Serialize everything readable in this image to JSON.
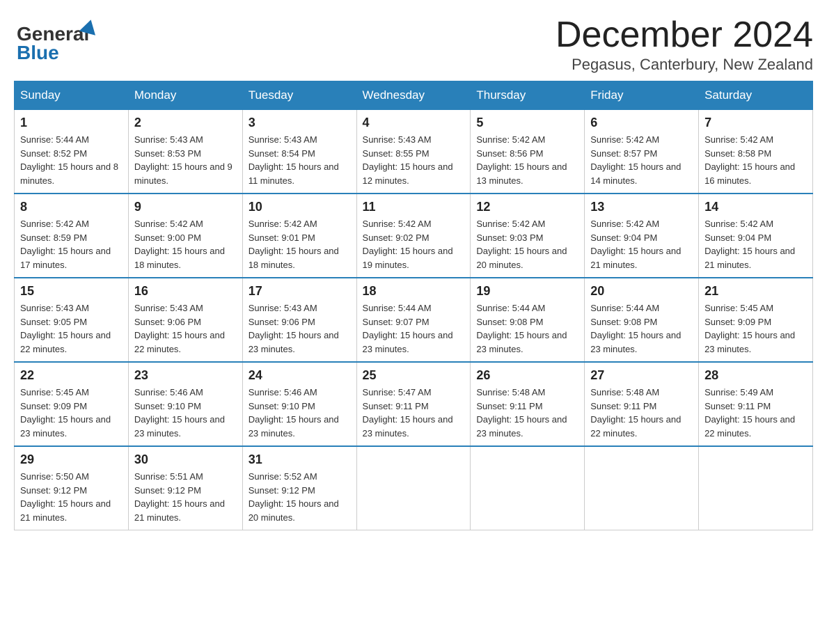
{
  "header": {
    "logo_text_general": "General",
    "logo_text_blue": "Blue",
    "month_title": "December 2024",
    "location": "Pegasus, Canterbury, New Zealand"
  },
  "days_of_week": [
    "Sunday",
    "Monday",
    "Tuesday",
    "Wednesday",
    "Thursday",
    "Friday",
    "Saturday"
  ],
  "weeks": [
    [
      {
        "day": "1",
        "sunrise": "5:44 AM",
        "sunset": "8:52 PM",
        "daylight": "15 hours and 8 minutes."
      },
      {
        "day": "2",
        "sunrise": "5:43 AM",
        "sunset": "8:53 PM",
        "daylight": "15 hours and 9 minutes."
      },
      {
        "day": "3",
        "sunrise": "5:43 AM",
        "sunset": "8:54 PM",
        "daylight": "15 hours and 11 minutes."
      },
      {
        "day": "4",
        "sunrise": "5:43 AM",
        "sunset": "8:55 PM",
        "daylight": "15 hours and 12 minutes."
      },
      {
        "day": "5",
        "sunrise": "5:42 AM",
        "sunset": "8:56 PM",
        "daylight": "15 hours and 13 minutes."
      },
      {
        "day": "6",
        "sunrise": "5:42 AM",
        "sunset": "8:57 PM",
        "daylight": "15 hours and 14 minutes."
      },
      {
        "day": "7",
        "sunrise": "5:42 AM",
        "sunset": "8:58 PM",
        "daylight": "15 hours and 16 minutes."
      }
    ],
    [
      {
        "day": "8",
        "sunrise": "5:42 AM",
        "sunset": "8:59 PM",
        "daylight": "15 hours and 17 minutes."
      },
      {
        "day": "9",
        "sunrise": "5:42 AM",
        "sunset": "9:00 PM",
        "daylight": "15 hours and 18 minutes."
      },
      {
        "day": "10",
        "sunrise": "5:42 AM",
        "sunset": "9:01 PM",
        "daylight": "15 hours and 18 minutes."
      },
      {
        "day": "11",
        "sunrise": "5:42 AM",
        "sunset": "9:02 PM",
        "daylight": "15 hours and 19 minutes."
      },
      {
        "day": "12",
        "sunrise": "5:42 AM",
        "sunset": "9:03 PM",
        "daylight": "15 hours and 20 minutes."
      },
      {
        "day": "13",
        "sunrise": "5:42 AM",
        "sunset": "9:04 PM",
        "daylight": "15 hours and 21 minutes."
      },
      {
        "day": "14",
        "sunrise": "5:42 AM",
        "sunset": "9:04 PM",
        "daylight": "15 hours and 21 minutes."
      }
    ],
    [
      {
        "day": "15",
        "sunrise": "5:43 AM",
        "sunset": "9:05 PM",
        "daylight": "15 hours and 22 minutes."
      },
      {
        "day": "16",
        "sunrise": "5:43 AM",
        "sunset": "9:06 PM",
        "daylight": "15 hours and 22 minutes."
      },
      {
        "day": "17",
        "sunrise": "5:43 AM",
        "sunset": "9:06 PM",
        "daylight": "15 hours and 23 minutes."
      },
      {
        "day": "18",
        "sunrise": "5:44 AM",
        "sunset": "9:07 PM",
        "daylight": "15 hours and 23 minutes."
      },
      {
        "day": "19",
        "sunrise": "5:44 AM",
        "sunset": "9:08 PM",
        "daylight": "15 hours and 23 minutes."
      },
      {
        "day": "20",
        "sunrise": "5:44 AM",
        "sunset": "9:08 PM",
        "daylight": "15 hours and 23 minutes."
      },
      {
        "day": "21",
        "sunrise": "5:45 AM",
        "sunset": "9:09 PM",
        "daylight": "15 hours and 23 minutes."
      }
    ],
    [
      {
        "day": "22",
        "sunrise": "5:45 AM",
        "sunset": "9:09 PM",
        "daylight": "15 hours and 23 minutes."
      },
      {
        "day": "23",
        "sunrise": "5:46 AM",
        "sunset": "9:10 PM",
        "daylight": "15 hours and 23 minutes."
      },
      {
        "day": "24",
        "sunrise": "5:46 AM",
        "sunset": "9:10 PM",
        "daylight": "15 hours and 23 minutes."
      },
      {
        "day": "25",
        "sunrise": "5:47 AM",
        "sunset": "9:11 PM",
        "daylight": "15 hours and 23 minutes."
      },
      {
        "day": "26",
        "sunrise": "5:48 AM",
        "sunset": "9:11 PM",
        "daylight": "15 hours and 23 minutes."
      },
      {
        "day": "27",
        "sunrise": "5:48 AM",
        "sunset": "9:11 PM",
        "daylight": "15 hours and 22 minutes."
      },
      {
        "day": "28",
        "sunrise": "5:49 AM",
        "sunset": "9:11 PM",
        "daylight": "15 hours and 22 minutes."
      }
    ],
    [
      {
        "day": "29",
        "sunrise": "5:50 AM",
        "sunset": "9:12 PM",
        "daylight": "15 hours and 21 minutes."
      },
      {
        "day": "30",
        "sunrise": "5:51 AM",
        "sunset": "9:12 PM",
        "daylight": "15 hours and 21 minutes."
      },
      {
        "day": "31",
        "sunrise": "5:52 AM",
        "sunset": "9:12 PM",
        "daylight": "15 hours and 20 minutes."
      },
      null,
      null,
      null,
      null
    ]
  ]
}
